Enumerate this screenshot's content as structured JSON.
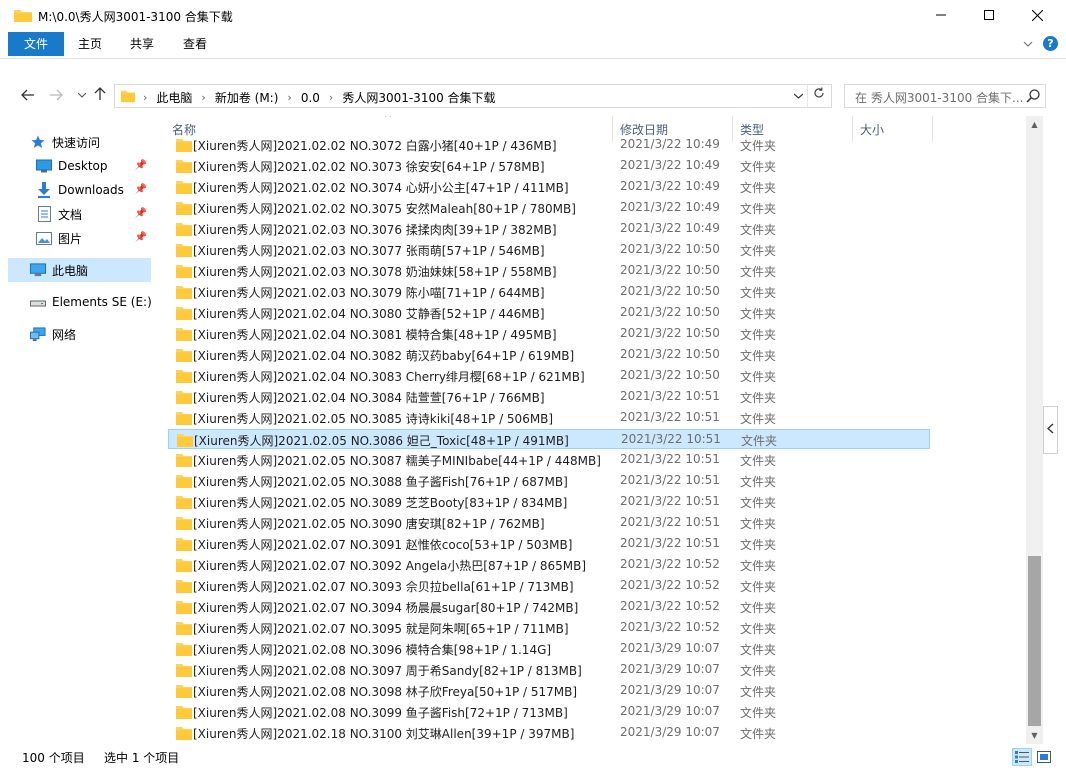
{
  "window": {
    "title": "M:\\0.0\\秀人网3001-3100 合集下载"
  },
  "ribbon": {
    "tabs": [
      "文件",
      "主页",
      "共享",
      "查看"
    ]
  },
  "address": {
    "crumbs": [
      "此电脑",
      "新加卷 (M:)",
      "0.0",
      "秀人网3001-3100 合集下载"
    ],
    "search_placeholder": "在 秀人网3001-3100 合集下..."
  },
  "nav": {
    "items": [
      {
        "label": "快速访问",
        "icon": "star-icon"
      },
      {
        "label": "Desktop",
        "icon": "desktop-icon",
        "pinned": true
      },
      {
        "label": "Downloads",
        "icon": "download-icon",
        "pinned": true
      },
      {
        "label": "文档",
        "icon": "document-icon",
        "pinned": true
      },
      {
        "label": "图片",
        "icon": "picture-icon",
        "pinned": true
      },
      {
        "label": "此电脑",
        "icon": "computer-icon",
        "selected": true
      },
      {
        "label": "Elements SE (E:)",
        "icon": "drive-icon"
      },
      {
        "label": "网络",
        "icon": "network-icon"
      }
    ]
  },
  "columns": {
    "name": "名称",
    "date": "修改日期",
    "type": "类型",
    "size": "大小"
  },
  "files": [
    {
      "name": "[Xiuren秀人网]2021.02.02 NO.3072 白露小猪[40+1P / 436MB]",
      "date": "2021/3/22 10:49",
      "type": "文件夹"
    },
    {
      "name": "[Xiuren秀人网]2021.02.02 NO.3073 徐安安[64+1P / 578MB]",
      "date": "2021/3/22 10:49",
      "type": "文件夹"
    },
    {
      "name": "[Xiuren秀人网]2021.02.02 NO.3074 心妍小公主[47+1P / 411MB]",
      "date": "2021/3/22 10:49",
      "type": "文件夹"
    },
    {
      "name": "[Xiuren秀人网]2021.02.02 NO.3075 安然Maleah[80+1P / 780MB]",
      "date": "2021/3/22 10:49",
      "type": "文件夹"
    },
    {
      "name": "[Xiuren秀人网]2021.02.03 NO.3076 揉揉肉肉[39+1P / 382MB]",
      "date": "2021/3/22 10:49",
      "type": "文件夹"
    },
    {
      "name": "[Xiuren秀人网]2021.02.03 NO.3077 张雨萌[57+1P / 546MB]",
      "date": "2021/3/22 10:50",
      "type": "文件夹"
    },
    {
      "name": "[Xiuren秀人网]2021.02.03 NO.3078 奶油妹妹[58+1P / 558MB]",
      "date": "2021/3/22 10:50",
      "type": "文件夹"
    },
    {
      "name": "[Xiuren秀人网]2021.02.03 NO.3079 陈小喵[71+1P / 644MB]",
      "date": "2021/3/22 10:50",
      "type": "文件夹"
    },
    {
      "name": "[Xiuren秀人网]2021.02.04 NO.3080 艾静香[52+1P / 446MB]",
      "date": "2021/3/22 10:50",
      "type": "文件夹"
    },
    {
      "name": "[Xiuren秀人网]2021.02.04 NO.3081 模特合集[48+1P / 495MB]",
      "date": "2021/3/22 10:50",
      "type": "文件夹"
    },
    {
      "name": "[Xiuren秀人网]2021.02.04 NO.3082 萌汉药baby[64+1P / 619MB]",
      "date": "2021/3/22 10:50",
      "type": "文件夹"
    },
    {
      "name": "[Xiuren秀人网]2021.02.04 NO.3083 Cherry绯月樱[68+1P / 621MB]",
      "date": "2021/3/22 10:50",
      "type": "文件夹"
    },
    {
      "name": "[Xiuren秀人网]2021.02.04 NO.3084 陆萱萱[76+1P / 766MB]",
      "date": "2021/3/22 10:51",
      "type": "文件夹"
    },
    {
      "name": "[Xiuren秀人网]2021.02.05 NO.3085 诗诗kiki[48+1P / 506MB]",
      "date": "2021/3/22 10:51",
      "type": "文件夹"
    },
    {
      "name": "[Xiuren秀人网]2021.02.05 NO.3086 妲己_Toxic[48+1P / 491MB]",
      "date": "2021/3/22 10:51",
      "type": "文件夹",
      "selected": true
    },
    {
      "name": "[Xiuren秀人网]2021.02.05 NO.3087 糯美子MINIbabe[44+1P / 448MB]",
      "date": "2021/3/22 10:51",
      "type": "文件夹"
    },
    {
      "name": "[Xiuren秀人网]2021.02.05 NO.3088 鱼子酱Fish[76+1P / 687MB]",
      "date": "2021/3/22 10:51",
      "type": "文件夹"
    },
    {
      "name": "[Xiuren秀人网]2021.02.05 NO.3089 芝芝Booty[83+1P / 834MB]",
      "date": "2021/3/22 10:51",
      "type": "文件夹"
    },
    {
      "name": "[Xiuren秀人网]2021.02.05 NO.3090 唐安琪[82+1P / 762MB]",
      "date": "2021/3/22 10:51",
      "type": "文件夹"
    },
    {
      "name": "[Xiuren秀人网]2021.02.07 NO.3091 赵惟依coco[53+1P / 503MB]",
      "date": "2021/3/22 10:51",
      "type": "文件夹"
    },
    {
      "name": "[Xiuren秀人网]2021.02.07 NO.3092 Angela小热巴[87+1P / 865MB]",
      "date": "2021/3/22 10:52",
      "type": "文件夹"
    },
    {
      "name": "[Xiuren秀人网]2021.02.07 NO.3093 佘贝拉bella[61+1P / 713MB]",
      "date": "2021/3/22 10:52",
      "type": "文件夹"
    },
    {
      "name": "[Xiuren秀人网]2021.02.07 NO.3094 杨晨晨sugar[80+1P / 742MB]",
      "date": "2021/3/22 10:52",
      "type": "文件夹"
    },
    {
      "name": "[Xiuren秀人网]2021.02.07 NO.3095 就是阿朱啊[65+1P / 711MB]",
      "date": "2021/3/22 10:52",
      "type": "文件夹"
    },
    {
      "name": "[Xiuren秀人网]2021.02.08 NO.3096 模特合集[98+1P / 1.14G]",
      "date": "2021/3/29 10:07",
      "type": "文件夹"
    },
    {
      "name": "[Xiuren秀人网]2021.02.08 NO.3097 周于希Sandy[82+1P / 813MB]",
      "date": "2021/3/29 10:07",
      "type": "文件夹"
    },
    {
      "name": "[Xiuren秀人网]2021.02.08 NO.3098 林子欣Freya[50+1P / 517MB]",
      "date": "2021/3/29 10:07",
      "type": "文件夹"
    },
    {
      "name": "[Xiuren秀人网]2021.02.08 NO.3099 鱼子酱Fish[72+1P / 713MB]",
      "date": "2021/3/29 10:07",
      "type": "文件夹"
    },
    {
      "name": "[Xiuren秀人网]2021.02.18 NO.3100 刘艾琳Allen[39+1P / 397MB]",
      "date": "2021/3/29 10:07",
      "type": "文件夹"
    }
  ],
  "status": {
    "count": "100 个项目",
    "selected": "选中 1 个项目"
  },
  "colors": {
    "accent": "#1979ca",
    "folder": "#ffd35a",
    "selection": "#cce8ff"
  }
}
